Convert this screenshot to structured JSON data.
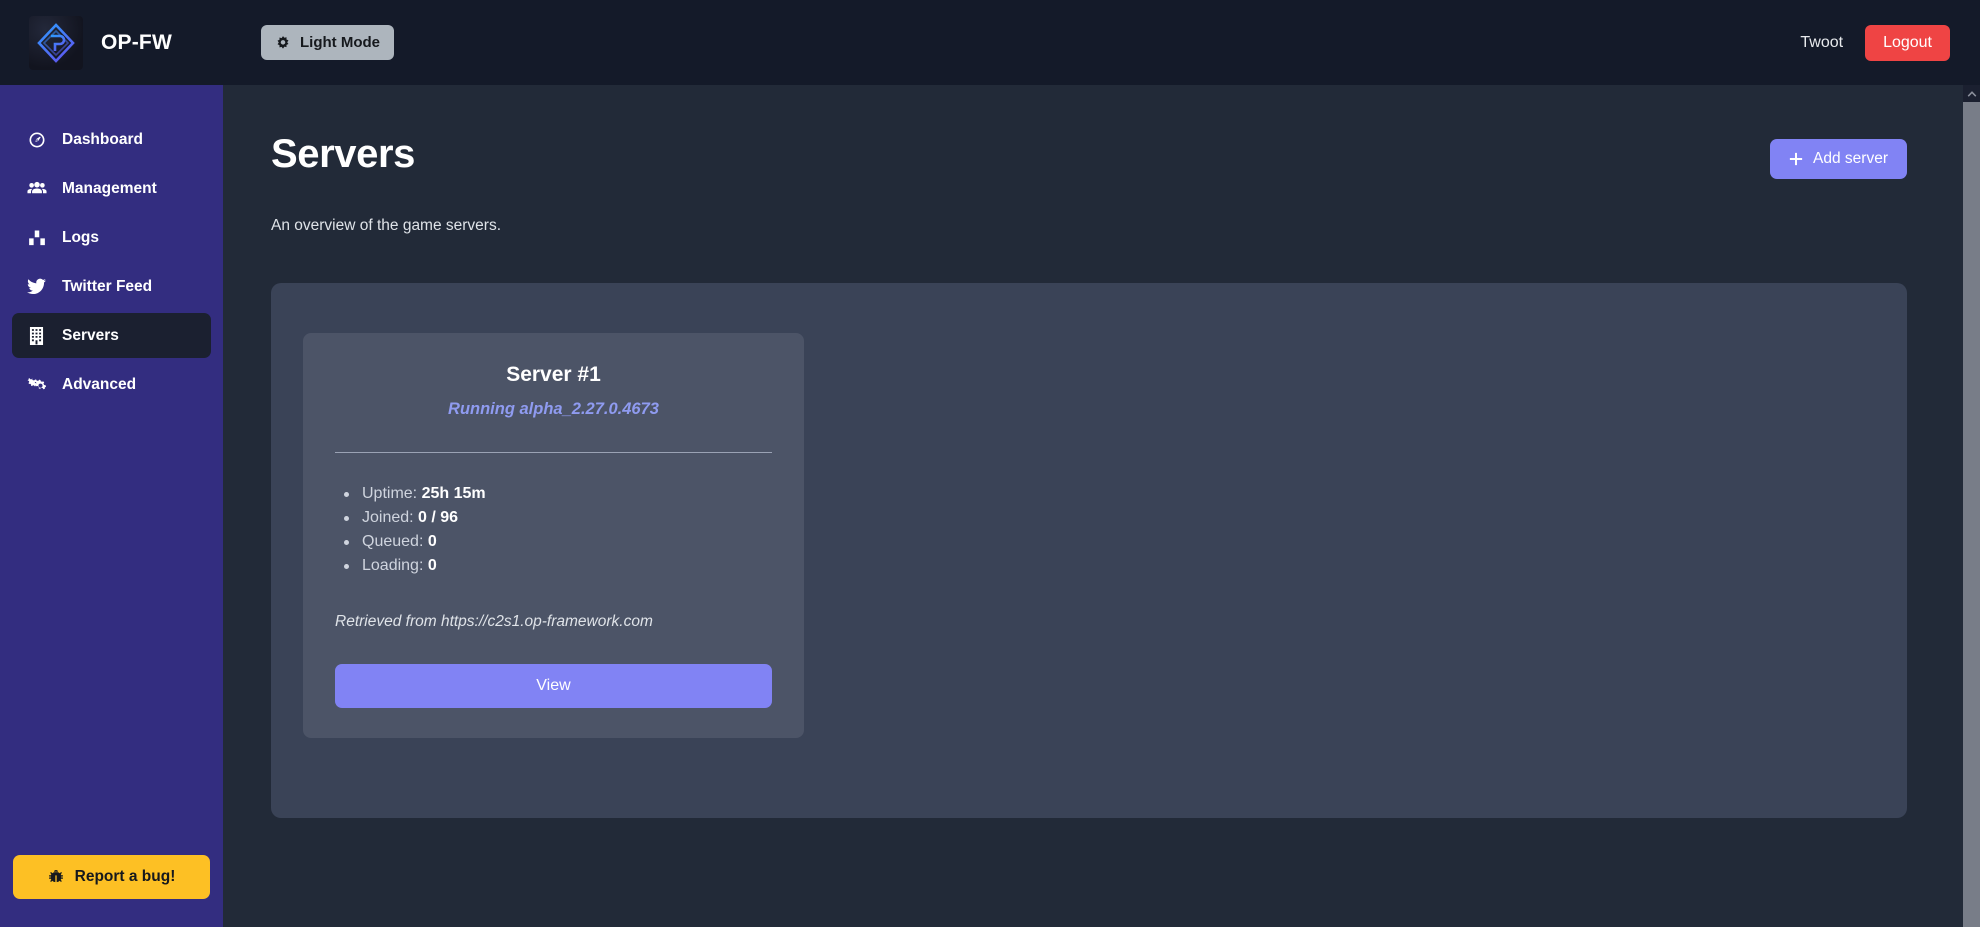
{
  "navbar": {
    "brand_name": "OP-FW",
    "brand_logo_icon": "op-fw-diamond-logo",
    "light_mode_label": "Light Mode",
    "light_mode_icon": "sun-gear-icon",
    "user_label": "Twoot",
    "logout_label": "Logout",
    "colors": {
      "background": "#141a29",
      "logout_red": "#ef4444",
      "light_mode_bg": "#adb5bd"
    }
  },
  "sidebar": {
    "color": "#332d80",
    "active_item_color": "#1b2030",
    "items": [
      {
        "label": "Dashboard",
        "icon": "gauge-icon",
        "active": false
      },
      {
        "label": "Management",
        "icon": "users-icon",
        "active": false
      },
      {
        "label": "Logs",
        "icon": "chart-bar-icon",
        "active": false
      },
      {
        "label": "Twitter Feed",
        "icon": "twitter-icon",
        "active": false
      },
      {
        "label": "Servers",
        "icon": "building-icon",
        "active": true
      },
      {
        "label": "Advanced",
        "icon": "cogs-icon",
        "active": false
      }
    ],
    "report_bug": {
      "label": "Report a bug!",
      "icon": "bug-icon",
      "color": "#fdc024"
    }
  },
  "main": {
    "page_title": "Servers",
    "page_subtitle": "An overview of the game servers.",
    "add_server": {
      "label": "Add server",
      "icon": "plus-icon",
      "color": "#8183f4"
    },
    "panel_color": "#3a4357",
    "servers": [
      {
        "name": "Server #1",
        "status": "Running alpha_2.27.0.4673",
        "stats": [
          {
            "label": "Uptime:",
            "value": "25h 15m"
          },
          {
            "label": "Joined:",
            "value": "0 / 96"
          },
          {
            "label": "Queued:",
            "value": "0"
          },
          {
            "label": "Loading:",
            "value": "0"
          }
        ],
        "source": "Retrieved from https://c2s1.op-framework.com",
        "view_label": "View"
      }
    ]
  },
  "scrollbar": {
    "up_arrow_icon": "chevron-up-icon",
    "thumb_color": "#787d88"
  }
}
